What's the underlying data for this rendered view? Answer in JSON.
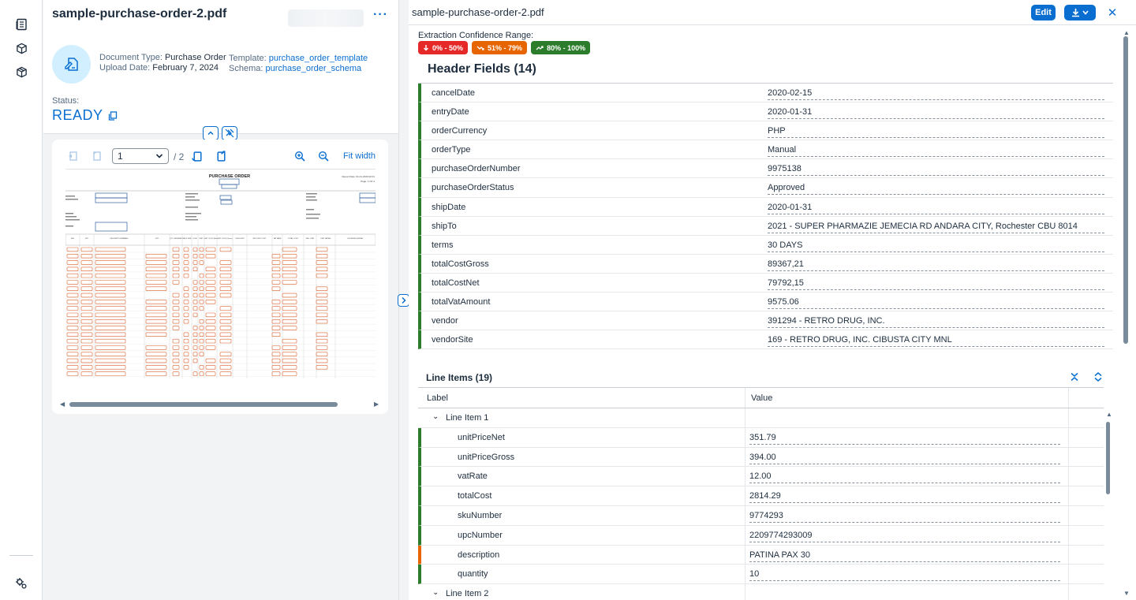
{
  "document": {
    "title": "sample-purchase-order-2.pdf",
    "more_label": "···",
    "type_label": "Document Type:",
    "type_value": "Purchase Order",
    "upload_label": "Upload Date:",
    "upload_value": "February 7, 2024",
    "template_label": "Template:",
    "template_value": "purchase_order_template",
    "schema_label": "Schema:",
    "schema_value": "purchase_order_schema",
    "status_label": "Status:",
    "status_value": "READY"
  },
  "viewer": {
    "page_value": "1",
    "page_total": "/ 2",
    "fit_width_label": "Fit width",
    "pdf": {
      "heading": "PURCHASE ORDER",
      "report_date": "Report Date: 01-01-2020 02:01",
      "page_label": "Page: 1 OF 2",
      "columns": [
        "SKU",
        "UPC",
        "DESCRIPTION/BRAND",
        "UPC",
        "QTY ORDERED",
        "PACK SIZE",
        "UOM",
        "UNIT",
        "UNIT COST (Net)",
        "UNIT COST (Gross)",
        "DISCOUNT",
        "NET UNIT COST",
        "VAT RATE",
        "TOTAL COST",
        "SELL UNIT",
        "UNIT RETAIL",
        "EXTENDED RETAIL"
      ]
    }
  },
  "panel": {
    "title": "sample-purchase-order-2.pdf",
    "edit_label": "Edit",
    "close_label": "✕",
    "confidence_label": "Extraction Confidence Range:",
    "chips": [
      {
        "label": "0% - 50%",
        "color": "#e52929"
      },
      {
        "label": "51% - 79%",
        "color": "#e76500"
      },
      {
        "label": "80% - 100%",
        "color": "#2b7d2b"
      }
    ]
  },
  "header_fields": {
    "title": "Header Fields (14)",
    "rows": [
      {
        "key": "cancelDate",
        "value": "2020-02-15"
      },
      {
        "key": "entryDate",
        "value": "2020-01-31"
      },
      {
        "key": "orderCurrency",
        "value": "PHP"
      },
      {
        "key": "orderType",
        "value": "Manual"
      },
      {
        "key": "purchaseOrderNumber",
        "value": "9975138"
      },
      {
        "key": "purchaseOrderStatus",
        "value": "Approved"
      },
      {
        "key": "shipDate",
        "value": "2020-01-31"
      },
      {
        "key": "shipTo",
        "value": "2021 - SUPER PHARMAZIE JEMECIA RD ANDARA CITY, Rochester CBU 8014"
      },
      {
        "key": "terms",
        "value": "30 DAYS"
      },
      {
        "key": "totalCostGross",
        "value": "89367,21"
      },
      {
        "key": "totalCostNet",
        "value": "79792,15"
      },
      {
        "key": "totalVatAmount",
        "value": "9575.06"
      },
      {
        "key": "vendor",
        "value": "391294 - RETRO DRUG, INC."
      },
      {
        "key": "vendorSite",
        "value": "169 - RETRO DRUG, INC. CIBUSTA CITY MNL"
      }
    ]
  },
  "line_items": {
    "title": "Line Items (19)",
    "col_label": "Label",
    "col_value": "Value",
    "group1": "Line Item 1",
    "group2": "Line Item 2",
    "rows": [
      {
        "key": "unitPriceNet",
        "value": "351.79"
      },
      {
        "key": "unitPriceGross",
        "value": "394.00"
      },
      {
        "key": "vatRate",
        "value": "12.00"
      },
      {
        "key": "totalCost",
        "value": "2814.29"
      },
      {
        "key": "skuNumber",
        "value": "9774293"
      },
      {
        "key": "upcNumber",
        "value": "2209774293009"
      },
      {
        "key": "description",
        "value": "PATINA PAX 30"
      },
      {
        "key": "quantity",
        "value": "10"
      }
    ]
  },
  "colors": {
    "accent": "#0a6ed1",
    "high": "#2b7d2b",
    "medium": "#e76500",
    "low": "#e52929"
  }
}
